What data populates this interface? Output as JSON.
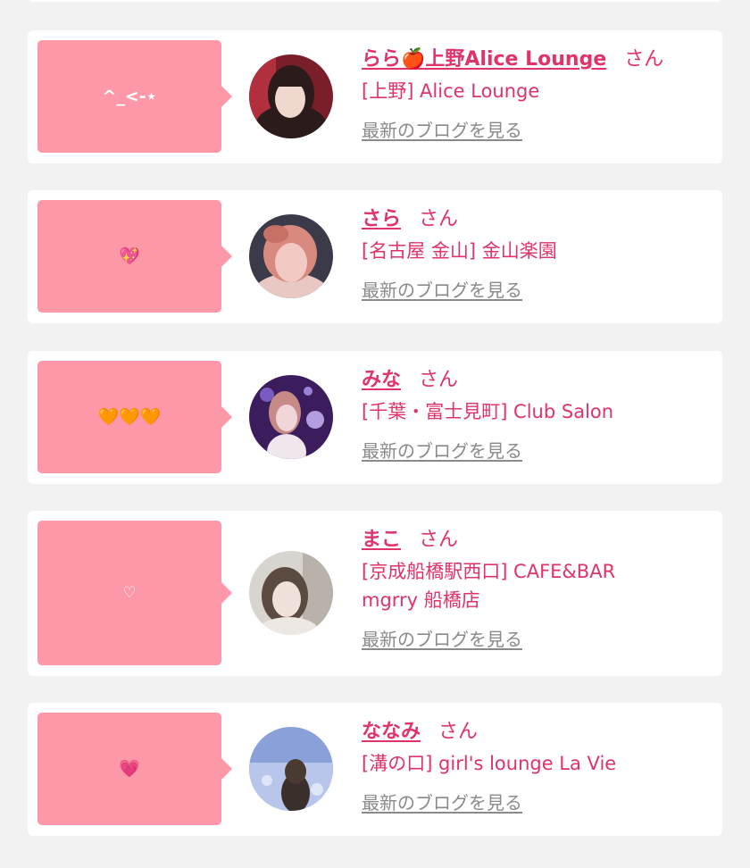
{
  "listing": {
    "cards": [
      {
        "message": "^_<-⋆",
        "name": "らら🍎上野Alice Lounge",
        "honorific": "さん",
        "shop": "[上野] Alice Lounge",
        "blog_link": "最新のブログを見る",
        "avatar_colors": [
          "#7a1f2a",
          "#f1d8cf",
          "#2b1b1b"
        ]
      },
      {
        "message": "💖",
        "name": "さら",
        "honorific": "さん",
        "shop": "[名古屋 金山] 金山楽園",
        "blog_link": "最新のブログを見る",
        "avatar_colors": [
          "#3a3a48",
          "#f3c9c4",
          "#d88a7e"
        ]
      },
      {
        "message": "🧡🧡🧡",
        "name": "みな",
        "honorific": "さん",
        "shop": "[千葉・富士見町] Club Salon",
        "blog_link": "最新のブログを見る",
        "avatar_colors": [
          "#3b1d5e",
          "#f0d6d8",
          "#b49ee0"
        ]
      },
      {
        "message": "♡",
        "name": "まこ",
        "honorific": "さん",
        "shop": "[京成船橋駅西口] CAFE&BAR mgrry 船橋店",
        "blog_link": "最新のブログを見る",
        "avatar_colors": [
          "#d8d4cf",
          "#f0e2da",
          "#5a4a40"
        ]
      },
      {
        "message": "💗",
        "name": "ななみ",
        "honorific": "さん",
        "shop": "[溝の口] girl's lounge La Vie",
        "blog_link": "最新のブログを見る",
        "avatar_colors": [
          "#8aa0d8",
          "#b8c6ec",
          "#3a2f2a"
        ]
      }
    ]
  }
}
